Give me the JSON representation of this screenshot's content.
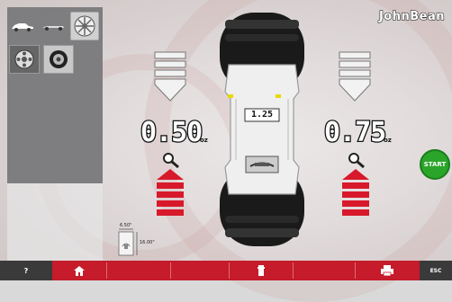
{
  "brand": "JohnBean",
  "center_value": "1.25",
  "left": {
    "weight": "0.50",
    "unit": "oz"
  },
  "right": {
    "weight": "0.75",
    "unit": "oz"
  },
  "start_label": "START",
  "dimensions": {
    "width": "6.50\"",
    "diameter": "16.00\""
  },
  "bottom_bar": {
    "help_label": "?",
    "esc_label": "ESC"
  },
  "colors": {
    "accent_red": "#c51b2a",
    "start_green": "#2aa52a",
    "panel_gray": "#7e7e80"
  },
  "icons": [
    "car-balance-icon",
    "truck-balance-icon",
    "wheel-rim-icon",
    "alloy-wheel-icon",
    "tire-wheel-icon",
    "home-icon",
    "clip-weight-icon",
    "printer-icon",
    "magnifier-icon"
  ]
}
